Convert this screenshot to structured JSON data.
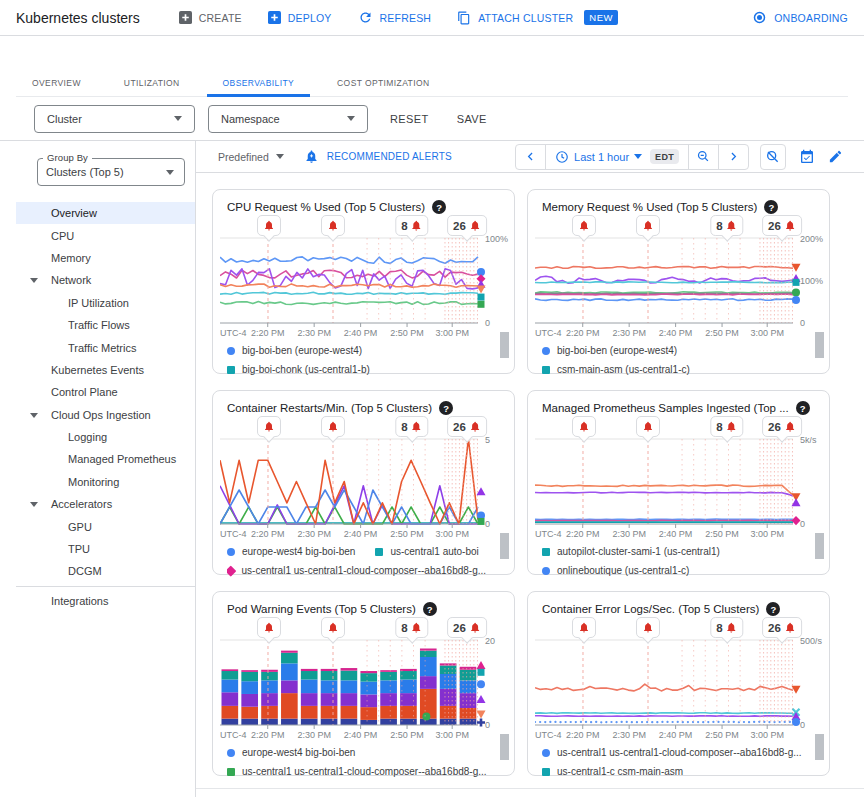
{
  "header": {
    "title": "Kubernetes clusters",
    "buttons": {
      "create": "CREATE",
      "deploy": "DEPLOY",
      "refresh": "REFRESH",
      "attach": "ATTACH CLUSTER",
      "new_badge": "NEW",
      "onboarding": "ONBOARDING"
    }
  },
  "tabs": [
    {
      "label": "OVERVIEW",
      "active": false
    },
    {
      "label": "UTILIZATION",
      "active": false
    },
    {
      "label": "OBSERVABILITY",
      "active": true
    },
    {
      "label": "COST OPTIMIZATION",
      "active": false
    }
  ],
  "filters": {
    "cluster": "Cluster",
    "namespace": "Namespace",
    "reset": "RESET",
    "save": "SAVE"
  },
  "sidebar": {
    "group_by_label": "Group By",
    "group_by_value": "Clusters (Top 5)",
    "items": [
      {
        "label": "Overview",
        "level": 0,
        "active": true
      },
      {
        "label": "CPU",
        "level": 0
      },
      {
        "label": "Memory",
        "level": 0
      },
      {
        "label": "Network",
        "level": 0,
        "expandable": true
      },
      {
        "label": "IP Utilization",
        "level": 1
      },
      {
        "label": "Traffic Flows",
        "level": 1
      },
      {
        "label": "Traffic Metrics",
        "level": 1
      },
      {
        "label": "Kubernetes Events",
        "level": 0
      },
      {
        "label": "Control Plane",
        "level": 0
      },
      {
        "label": "Cloud Ops Ingestion",
        "level": 0,
        "expandable": true
      },
      {
        "label": "Logging",
        "level": 1
      },
      {
        "label": "Managed Prometheus",
        "level": 1
      },
      {
        "label": "Monitoring",
        "level": 1
      },
      {
        "label": "Accelerators",
        "level": 0,
        "expandable": true
      },
      {
        "label": "GPU",
        "level": 1
      },
      {
        "label": "TPU",
        "level": 1
      },
      {
        "label": "DCGM",
        "level": 1
      },
      {
        "label": "Integrations",
        "level": 0,
        "divider_before": true
      }
    ]
  },
  "toolbar": {
    "predefined": "Predefined",
    "recommended_alerts": "RECOMMENDED ALERTS",
    "time_range": "Last 1 hour",
    "timezone": "EDT"
  },
  "icons": {
    "help": "?"
  },
  "alert_chips": {
    "labels": [
      "",
      "",
      "8",
      "26"
    ],
    "fracs": [
      0.19,
      0.438,
      0.744,
      0.957
    ]
  },
  "alert_lines": {
    "singles": [
      0.186,
      0.438
    ],
    "mid_cluster": [
      0.57,
      0.615,
      0.66,
      0.705,
      0.75,
      0.795
    ],
    "right_cluster": [
      0.872,
      0.886,
      0.9,
      0.914,
      0.928,
      0.942,
      0.956,
      0.97,
      0.984,
      0.998
    ]
  },
  "x_axis": {
    "left_label": "UTC-4",
    "ticks": [
      "2:20 PM",
      "2:30 PM",
      "2:40 PM",
      "2:50 PM",
      "3:00 PM"
    ],
    "tick_fracs": [
      0.185,
      0.365,
      0.545,
      0.725,
      0.9
    ]
  },
  "chart_data": [
    {
      "type": "line",
      "title": "CPU Request % Used (Top 5 Clusters)",
      "y_labels": [
        {
          "frac": 1,
          "text": "100%"
        },
        {
          "frac": 0,
          "text": "0"
        }
      ],
      "ylim": [
        0,
        100
      ],
      "series": [
        {
          "name": "big-boi-ben",
          "color": "#5e97f6",
          "mode": "noise",
          "base": 0.74,
          "amp": 0.04,
          "seed": 11
        },
        {
          "name": "magenta",
          "color": "#d8509e",
          "mode": "noise",
          "base": 0.575,
          "amp": 0.05,
          "seed": 12
        },
        {
          "name": "purple",
          "color": "#9e53ef",
          "mode": "noise",
          "base": 0.52,
          "amp": 0.12,
          "seed": 13
        },
        {
          "name": "orange",
          "color": "#f2835c",
          "mode": "noise",
          "base": 0.44,
          "amp": 0.02,
          "seed": 14
        },
        {
          "name": "cyan",
          "color": "#52c7d8",
          "mode": "noise",
          "base": 0.35,
          "amp": 0.012,
          "seed": 15
        },
        {
          "name": "green",
          "color": "#69c98a",
          "mode": "noise",
          "base": 0.235,
          "amp": 0.018,
          "seed": 16
        }
      ],
      "markers": [
        {
          "shape": "circle",
          "color": "#4285f4",
          "y": 0.6
        },
        {
          "shape": "diamond",
          "color": "#e0218f",
          "y": 0.52
        },
        {
          "shape": "tri-up",
          "color": "#9334e6",
          "y": 0.455
        },
        {
          "shape": "tri-down",
          "color": "#f2835c",
          "y": 0.4
        },
        {
          "shape": "square",
          "color": "#12a4af",
          "y": 0.305
        },
        {
          "shape": "square",
          "color": "#34a853",
          "y": 0.22
        }
      ],
      "legend_rows": [
        [
          {
            "marker": "circle",
            "color": "#4285f4",
            "label": "big-boi-ben (europe-west4)"
          }
        ],
        [
          {
            "marker": "square",
            "color": "#12a4af",
            "label": "big-boi-chonk (us-central1-b)"
          }
        ]
      ]
    },
    {
      "type": "line",
      "title": "Memory Request % Used (Top 5 Clusters)",
      "y_labels": [
        {
          "frac": 1,
          "text": "200%"
        },
        {
          "frac": 0.5,
          "text": "100%"
        },
        {
          "frac": 0,
          "text": "0"
        }
      ],
      "ylim": [
        0,
        200
      ],
      "series": [
        {
          "name": "coral",
          "color": "#ee7762",
          "mode": "noise",
          "base": 0.655,
          "amp": 0.012,
          "seed": 21
        },
        {
          "name": "purple",
          "color": "#9e53ef",
          "mode": "noise",
          "base": 0.505,
          "amp": 0.02,
          "seed": 22,
          "wfreq": 0.8,
          "wamp": 0.025
        },
        {
          "name": "cyan",
          "color": "#52c7d8",
          "mode": "noise",
          "base": 0.478,
          "amp": 0.006,
          "seed": 23
        },
        {
          "name": "green",
          "color": "#69c98a",
          "mode": "noise",
          "base": 0.36,
          "amp": 0.008,
          "seed": 24
        },
        {
          "name": "gray",
          "color": "#80868b",
          "mode": "noise",
          "base": 0.345,
          "amp": 0.005,
          "seed": 25
        },
        {
          "name": "magenta",
          "color": "#d8509e",
          "mode": "noise",
          "base": 0.335,
          "amp": 0.005,
          "seed": 26
        },
        {
          "name": "blue",
          "color": "#5e97f6",
          "mode": "noise",
          "base": 0.275,
          "amp": 0.01,
          "seed": 27
        }
      ],
      "markers": [
        {
          "shape": "tri-down",
          "color": "#e8562e",
          "y": 0.655
        },
        {
          "shape": "tri-up",
          "color": "#9334e6",
          "y": 0.525
        },
        {
          "shape": "square",
          "color": "#12a4af",
          "y": 0.478
        },
        {
          "shape": "circle",
          "color": "#34a853",
          "y": 0.36
        },
        {
          "shape": "circle",
          "color": "#4285f4",
          "y": 0.27
        }
      ],
      "legend_rows": [
        [
          {
            "marker": "circle",
            "color": "#4285f4",
            "label": "big-boi-ben (europe-west4)"
          }
        ],
        [
          {
            "marker": "square",
            "color": "#12a4af",
            "label": "csm-main-asm (us-central1-c)"
          }
        ]
      ]
    },
    {
      "type": "line",
      "title": "Container Restarts/Min. (Top 5 Clusters)",
      "y_labels": [
        {
          "frac": 1,
          "text": "5"
        },
        {
          "frac": 0,
          "text": "0"
        }
      ],
      "ylim": [
        0,
        5
      ],
      "series": [
        {
          "name": "teal",
          "color": "#12a4af",
          "mode": "flat",
          "base": 0.012
        },
        {
          "name": "green",
          "color": "#3fae49",
          "mode": "spiky",
          "max": 0.2,
          "steps": 1,
          "seed": 33
        },
        {
          "name": "purple",
          "color": "#8e3fe8",
          "mode": "spiky",
          "max": 0.45,
          "steps": 2,
          "seed": 34,
          "zerobias": 0.45
        },
        {
          "name": "blue",
          "color": "#4e85e8",
          "mode": "spiky",
          "max": 0.4,
          "steps": 2,
          "seed": 35
        },
        {
          "name": "red",
          "color": "#e8562e",
          "mode": "spiky",
          "max": 0.75,
          "steps": 3,
          "seed": 36,
          "endspike": 1.0
        }
      ],
      "markers": [
        {
          "shape": "tri-up",
          "color": "#9334e6",
          "y": 0.38
        },
        {
          "shape": "circle",
          "color": "#4285f4",
          "y": 0.1
        },
        {
          "shape": "square",
          "color": "#34a853",
          "y": 0.03
        }
      ],
      "legend_rows": [
        [
          {
            "marker": "circle",
            "color": "#4285f4",
            "label": "europe-west4 big-boi-ben"
          },
          {
            "marker": "square",
            "color": "#12a4af",
            "label": "us-central1 auto-boi"
          }
        ],
        [
          {
            "marker": "diamond",
            "color": "#e0218f",
            "label": "us-central1 us-central1-cloud-composer--aba16bd8-g..."
          }
        ]
      ]
    },
    {
      "type": "line",
      "title": "Managed Prometheus Samples Ingested (Top ...",
      "y_labels": [
        {
          "frac": 1,
          "text": "5k/s"
        },
        {
          "frac": 0,
          "text": "0"
        }
      ],
      "ylim": [
        0,
        5000
      ],
      "series": [
        {
          "name": "orange",
          "color": "#f2835c",
          "mode": "noise",
          "base": 0.45,
          "amp": 0.008,
          "seed": 41,
          "enddrop": 0.34
        },
        {
          "name": "purple",
          "color": "#9e53ef",
          "mode": "noise",
          "base": 0.37,
          "amp": 0.004,
          "seed": 42,
          "enddrop": 0.33
        },
        {
          "name": "blue",
          "color": "#5e97f6",
          "mode": "noise",
          "base": 0.055,
          "amp": 0.003,
          "seed": 43
        },
        {
          "name": "magenta",
          "color": "#d8509e",
          "mode": "noise",
          "base": 0.04,
          "amp": 0.002,
          "seed": 44
        },
        {
          "name": "teal",
          "color": "#12a4af",
          "mode": "flat",
          "base": 0.022
        }
      ],
      "markers": [
        {
          "shape": "tri-down",
          "color": "#e8562e",
          "y": 0.32
        },
        {
          "shape": "tri-up",
          "color": "#9334e6",
          "y": 0.25
        },
        {
          "shape": "diamond",
          "color": "#e0218f",
          "y": 0.04
        }
      ],
      "legend_rows": [
        [
          {
            "marker": "square",
            "color": "#12a4af",
            "label": "autopilot-cluster-sami-1 (us-central1)"
          }
        ],
        [
          {
            "marker": "circle",
            "color": "#4285f4",
            "label": "onlineboutique (us-central1-c)"
          }
        ]
      ]
    },
    {
      "type": "bar",
      "title": "Pod Warning Events (Top 5 Clusters)",
      "y_labels": [
        {
          "frac": 1,
          "text": "20"
        },
        {
          "frac": 0,
          "text": "0"
        }
      ],
      "ylim": [
        0,
        20
      ],
      "bar_colors": [
        "#32409f",
        "#e04a23",
        "#8430ce",
        "#2a7cea",
        "#109d94",
        "#d6258f"
      ],
      "bars": [
        [
          1.5,
          3,
          3.2,
          3,
          2,
          0.4
        ],
        [
          1.5,
          2.8,
          3,
          3,
          2.2,
          0.4
        ],
        [
          1.5,
          3,
          3,
          3,
          2,
          0.5
        ],
        [
          1.5,
          6,
          3,
          4,
          2.5,
          0.5
        ],
        [
          1.5,
          3,
          3,
          3.2,
          2,
          0.5
        ],
        [
          1.5,
          3,
          3,
          3,
          2.2,
          0.5
        ],
        [
          1.5,
          3,
          3,
          3,
          2.3,
          0.6
        ],
        [
          1.2,
          3,
          3,
          3,
          2,
          0.5
        ],
        [
          1.5,
          3,
          3,
          3,
          2,
          0.4
        ],
        [
          1.5,
          3,
          3,
          3.2,
          2,
          0.5
        ],
        [
          1.5,
          7,
          3,
          4.5,
          1.5,
          0.5
        ],
        [
          1.5,
          3,
          4,
          3.5,
          2,
          0.5
        ],
        [
          1.5,
          2.5,
          3.5,
          3,
          2.5,
          0.7
        ]
      ],
      "mid_markers": [
        {
          "shape": "circle",
          "color": "#34a853",
          "xf": 0.8,
          "yf": 0.1
        }
      ],
      "markers": [
        {
          "shape": "tri-up",
          "color": "#e0218f",
          "y": 0.7
        },
        {
          "shape": "square",
          "color": "#12a4af",
          "y": 0.62
        },
        {
          "shape": "circle",
          "color": "#4285f4",
          "y": 0.48
        },
        {
          "shape": "tri-up",
          "color": "#9334e6",
          "y": 0.3
        },
        {
          "shape": "tri-down",
          "color": "#f2835c",
          "y": 0.13
        },
        {
          "shape": "plus",
          "color": "#32409f",
          "y": 0.03
        }
      ],
      "legend_rows": [
        [
          {
            "marker": "circle",
            "color": "#4285f4",
            "label": "europe-west4 big-boi-ben"
          }
        ],
        [
          {
            "marker": "square",
            "color": "#34a853",
            "label": "us-central1 us-central1-cloud-composer--aba16bd8-g..."
          }
        ]
      ]
    },
    {
      "type": "line",
      "title": "Container Error Logs/Sec. (Top 5 Clusters)",
      "y_labels": [
        {
          "frac": 1,
          "text": "500/s"
        },
        {
          "frac": 0,
          "text": "0"
        }
      ],
      "ylim": [
        0,
        500
      ],
      "series": [
        {
          "name": "orange",
          "color": "#ee7762",
          "mode": "noise",
          "base": 0.42,
          "amp": 0.02,
          "seed": 61,
          "spikep": 0.18,
          "spikeh": 0.05
        },
        {
          "name": "cyan",
          "color": "#52c7d8",
          "mode": "noise",
          "base": 0.14,
          "amp": 0.005,
          "seed": 62
        },
        {
          "name": "purple",
          "color": "#9e53ef",
          "mode": "noise",
          "base": 0.105,
          "amp": 0.003,
          "seed": 63
        },
        {
          "name": "blue",
          "color": "#5e97f6",
          "mode": "noise",
          "base": 0.035,
          "amp": 0.003,
          "seed": 64,
          "dotted": true
        }
      ],
      "markers": [
        {
          "shape": "tri-down",
          "color": "#e8562e",
          "y": 0.42
        },
        {
          "shape": "x",
          "color": "#52c7d8",
          "y": 0.15
        },
        {
          "shape": "tri-up",
          "color": "#9334e6",
          "y": 0.1
        },
        {
          "shape": "circle",
          "color": "#4285f4",
          "y": 0.035
        }
      ],
      "legend_rows": [
        [
          {
            "marker": "circle",
            "color": "#4285f4",
            "label": "us-central1 us-central1-cloud-composer--aba16bd8-g..."
          }
        ],
        [
          {
            "marker": "square",
            "color": "#12a4af",
            "label": "us-central1-c csm-main-asm"
          }
        ]
      ]
    }
  ]
}
